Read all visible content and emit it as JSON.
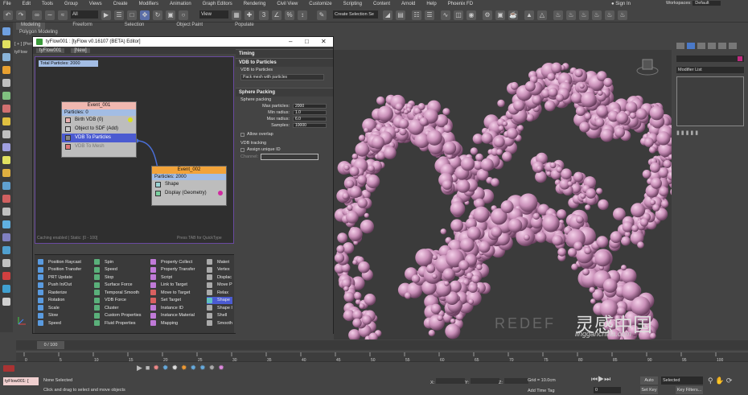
{
  "menus": [
    "File",
    "Edit",
    "Tools",
    "Group",
    "Views",
    "Create",
    "Modifiers",
    "Animation",
    "Graph Editors",
    "Rendering",
    "Civil View",
    "Customize",
    "Scripting",
    "Content",
    "Arnold",
    "Help",
    "Phoenix FD"
  ],
  "account": {
    "sign_in": "Sign In",
    "workspaces_label": "Workspaces:",
    "workspace_value": "Default"
  },
  "toolbar": {
    "filter_value": "All",
    "view_value": "View",
    "selection_set_placeholder": "Create Selection Se"
  },
  "ribbon": {
    "tabs": [
      "Modeling",
      "Freeform",
      "Selection",
      "Object Paint",
      "Populate"
    ],
    "subtitle": "Polygon Modeling"
  },
  "viewport": {
    "label": "[ + ] [Pers",
    "label2": "tyFlow"
  },
  "editor": {
    "title": "tyFlow001 : [tyFlow v0.16107 (BETA) Editor]",
    "tabs": [
      "tyFlow001",
      "[New]"
    ],
    "total_particles": "Total Particles: 2000",
    "caching_text": "Caching enabled | Static: [0 - 100]",
    "quicktype_hint": "Press TAB for QuickType",
    "event1": {
      "name": "Event_001",
      "particles": "Particles: 0",
      "ops": [
        "Birth VDB (0)",
        "Object to SDF (Add)",
        "VDB To Particles",
        "VDB To Mesh"
      ]
    },
    "event2": {
      "name": "Event_002",
      "particles": "Particles: 2000",
      "ops": [
        "Shape",
        "Display (Geometry)"
      ]
    }
  },
  "rollouts": {
    "timing": "Timing",
    "vdb_to_particles": "VDB to Particles",
    "vdb_label": "VDB to Particles",
    "vdb_mode": "Pack mesh with particles",
    "sphere_packing_title": "Sphere Packing",
    "sphere_packing_label": "Sphere packing",
    "fields": [
      {
        "label": "Max particles:",
        "value": "2000"
      },
      {
        "label": "Min radius:",
        "value": "1.0"
      },
      {
        "label": "Max radius:",
        "value": "6.0"
      },
      {
        "label": "Samples:",
        "value": "10000"
      }
    ],
    "allow_overlap": "Allow overlap",
    "vdb_tracking": "VDB tracking",
    "assign_unique_id": "Assign unique ID",
    "channel_label": "Channel:"
  },
  "operators": {
    "col1": [
      "Position Raycast",
      "Position Transfer",
      "PRT Update",
      "Push In/Out",
      "Rasterize",
      "Rotation",
      "Scale",
      "Slow",
      "Speed"
    ],
    "col2": [
      "Spin",
      "Speed",
      "Stop",
      "Surface Force",
      "Temporal Smooth",
      "VDB Force",
      "Cluster",
      "Custom Properties",
      "Fluid Properties"
    ],
    "col3": [
      "Property Collect",
      "Property Transfer",
      "Script",
      "Link to Target",
      "Move to Target",
      "Set Target",
      "Instance ID",
      "Instance Material",
      "Mapping"
    ],
    "col4": [
      "Materi",
      "Vertex",
      "Displac",
      "Move P",
      "Relax",
      "Shape",
      "Shape I",
      "Shell",
      "Smooth"
    ]
  },
  "command_panel": {
    "modifier_list": "Modifier List"
  },
  "timeline": {
    "frame": "0 / 100",
    "ticks": [
      "0",
      "5",
      "10",
      "15",
      "20",
      "25",
      "30",
      "35",
      "40",
      "45",
      "50",
      "55",
      "60",
      "65",
      "70",
      "75",
      "80",
      "85",
      "90",
      "95",
      "100"
    ]
  },
  "status": {
    "maxscript": "tyFlow001: [",
    "selection": "None Selected",
    "prompt": "Click and drag to select and move objects",
    "x_label": "X:",
    "y_label": "Y:",
    "z_label": "Z:",
    "grid": "Grid = 10.0cm",
    "add_time_tag": "Add Time Tag",
    "auto_key": "Auto Key",
    "set_key": "Set Key",
    "key_mode": "Selected",
    "key_filters": "Key Filters...",
    "frame_value": "0"
  },
  "watermark": {
    "brand": "REDEF",
    "site": "lingganchina.com",
    "cn": "灵感中国"
  },
  "colors": {
    "particle": "#c98fb8",
    "node_header1": "#f0b8b0",
    "node_header2": "#f2a33a",
    "selected_op": "#4b5bd1",
    "accent": "#6a4aa0"
  }
}
